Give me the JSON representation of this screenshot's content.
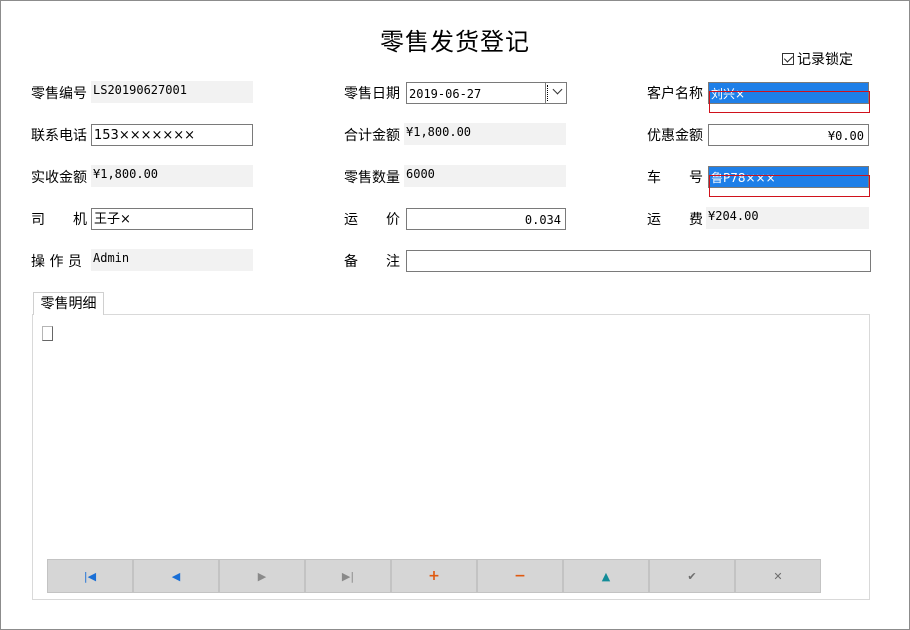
{
  "form": {
    "title": "零售发货登记",
    "record_lock": {
      "label": "记录锁定",
      "checked": true
    }
  },
  "fields": {
    "retail_no": {
      "label": "零售编号",
      "value": "LS20190627001"
    },
    "retail_date": {
      "label": "零售日期",
      "value": "2019-06-27"
    },
    "customer_name": {
      "label": "客户名称",
      "value": "刘兴×"
    },
    "phone": {
      "label": "联系电话",
      "value": "153×××××××"
    },
    "total_amount": {
      "label": "合计金额",
      "value": "¥1,800.00"
    },
    "discount": {
      "label": "优惠金额",
      "value": "¥0.00"
    },
    "received": {
      "label": "实收金额",
      "value": "¥1,800.00"
    },
    "quantity": {
      "label": "零售数量",
      "value": "6000"
    },
    "plate": {
      "label": "车　　号",
      "value": "鲁P78×××"
    },
    "driver": {
      "label": "司　　机",
      "value": "王子×"
    },
    "freight_price": {
      "label": "运　　价",
      "value": "0.034"
    },
    "freight": {
      "label": "运　　费",
      "value": "¥204.00"
    },
    "operator": {
      "label": "操 作 员",
      "value": "Admin"
    },
    "remark": {
      "label": "备　　注",
      "value": ""
    }
  },
  "detail": {
    "tab_label": "零售明细"
  },
  "navigator": {
    "buttons": [
      {
        "name": "first",
        "glyph": "|◀"
      },
      {
        "name": "prior",
        "glyph": "◀"
      },
      {
        "name": "next",
        "glyph": "▶"
      },
      {
        "name": "last",
        "glyph": "▶|"
      },
      {
        "name": "insert",
        "glyph": "+"
      },
      {
        "name": "delete",
        "glyph": "−"
      },
      {
        "name": "edit",
        "glyph": "▲"
      },
      {
        "name": "post",
        "glyph": "✔"
      },
      {
        "name": "cancel",
        "glyph": "✕"
      }
    ]
  },
  "colors": {
    "selection": "#1e7fe8",
    "annotation_red": "#d0121c",
    "readonly_bg": "#f2f2f2",
    "nav_bg": "#d6d6d6"
  }
}
